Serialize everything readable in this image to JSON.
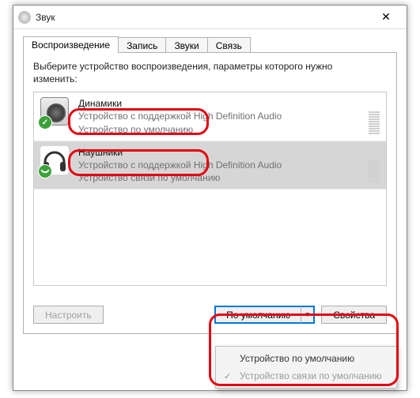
{
  "window": {
    "title": "Звук",
    "close_glyph": "✕"
  },
  "tabs": {
    "playback": "Воспроизведение",
    "recording": "Запись",
    "sounds": "Звуки",
    "comm": "Связь"
  },
  "instruction": "Выберите устройство воспроизведения, параметры которого нужно изменить:",
  "devices": [
    {
      "name": "Динамики",
      "desc": "Устройство с поддержкой High Definition Audio",
      "status": "Устройство по умолчанию",
      "badge": "check",
      "selected": false,
      "kind": "speaker"
    },
    {
      "name": "Наушники",
      "desc": "Устройство с поддержкой High Definition Audio",
      "status": "Устройство связи по умолчанию",
      "badge": "phone",
      "selected": true,
      "kind": "headphone"
    }
  ],
  "buttons": {
    "configure": "Настроить",
    "default": "По умолчанию",
    "default_arrow": "▼",
    "properties": "Свойства"
  },
  "dropdown": {
    "items": [
      {
        "label": "Устройство по умолчанию",
        "checked": false,
        "muted": false
      },
      {
        "label": "Устройство связи по умолчанию",
        "checked": true,
        "muted": true
      }
    ]
  }
}
